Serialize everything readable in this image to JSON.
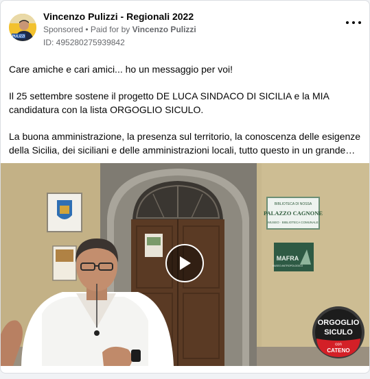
{
  "post": {
    "page_name": "Vincenzo Pulizzi - Regionali 2022",
    "sponsored_label": "Sponsored",
    "paid_for_prefix": "• Paid for by",
    "paid_for_name": "Vincenzo Pulizzi",
    "ad_id": "ID: 495280275939842",
    "avatar_text": "PULIZZI",
    "menu_icon": "more-horizontal-icon"
  },
  "body": {
    "paragraphs": [
      "Care amiche e cari amici... ho un messaggio per voi!",
      "Il 25 settembre sostene il progetto DE LUCA SINDACO DI SICILIA e la MIA candidatura con la lista ORGOGLIO SICULO.",
      "La buona amministrazione, la presenza sul territorio, la conoscenza delle esigenze della Sicilia, dei siciliani e delle amministrazioni locali, tutto questo in un grande…"
    ]
  },
  "video": {
    "sign_palazzo_small": "BIBLIOTECA DI NOSSA",
    "sign_palazzo_title": "PALAZZO CAGNONE",
    "sign_palazzo_sub": "MUSEO · BIBLIOTECA COMUNALE",
    "sign_mafra": "MAFRA",
    "sign_mafra_sub": "MUSEO ANTROPOLOGICO",
    "logo_line1": "ORGOGLIO",
    "logo_line2": "SICULO",
    "logo_con": "con",
    "logo_cateno": "CATENO",
    "play_icon": "play-icon",
    "colors": {
      "wall": "#c8b88e",
      "door": "#5a3a24",
      "logo_red": "#d32027"
    }
  }
}
